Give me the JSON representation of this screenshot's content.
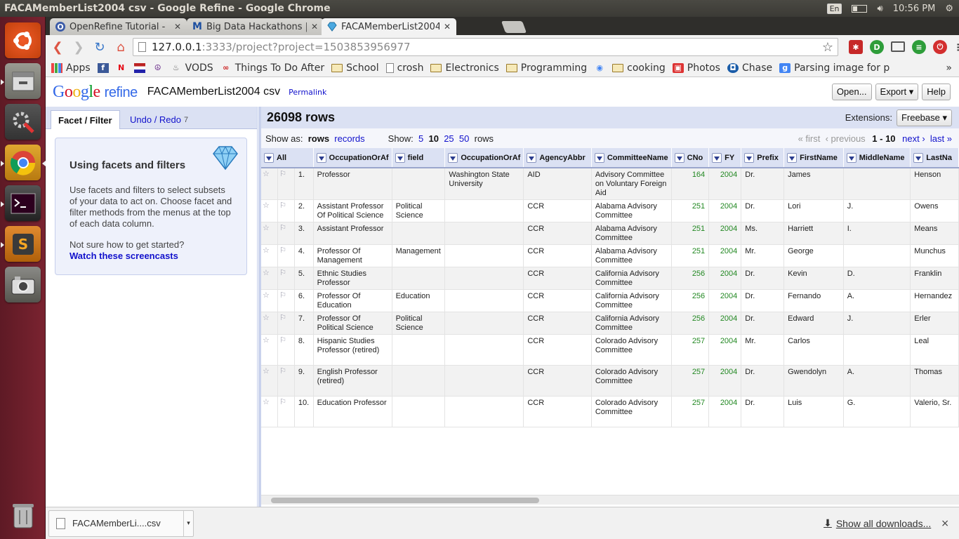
{
  "window": {
    "title": "FACAMemberList2004 csv - Google Refine - Google Chrome",
    "keyboard": "En",
    "clock": "10:56 PM"
  },
  "tabs": [
    {
      "label": "OpenRefine Tutorial -",
      "favicon": "O"
    },
    {
      "label": "Big Data Hackathons |",
      "favicon": "M"
    },
    {
      "label": "FACAMemberList2004",
      "favicon": "diamond"
    }
  ],
  "address": {
    "host": "127.0.0.1",
    "rest": ":3333/project?project=1503853956977"
  },
  "bookmarks": [
    "Apps",
    "",
    "",
    "",
    "",
    "VODS",
    "Things To Do After",
    "School",
    "crosh",
    "Electronics",
    "Programming",
    "",
    "cooking",
    "Photos",
    "Chase",
    "Parsing image for p"
  ],
  "bookmarks_more": "»",
  "app": {
    "logo_parts": [
      "G",
      "o",
      "o",
      "g",
      "l",
      "e"
    ],
    "logo_refine": "refine",
    "project_name": "FACAMemberList2004 csv",
    "permalink": "Permalink",
    "buttons": {
      "open": "Open...",
      "export": "Export ▾",
      "help": "Help"
    }
  },
  "left_panel": {
    "tab_facet": "Facet / Filter",
    "tab_undo": "Undo / Redo",
    "undo_count": "7",
    "help_title": "Using facets and filters",
    "help_text": "Use facets and filters to select subsets of your data to act on. Choose facet and filter methods from the menus at the top of each data column.",
    "help_prompt": "Not sure how to get started?",
    "help_link": "Watch these screencasts"
  },
  "view": {
    "row_count": "26098 rows",
    "extensions_label": "Extensions:",
    "extensions_button": "Freebase ▾",
    "show_as_label": "Show as:",
    "show_as_rows": "rows",
    "show_as_records": "records",
    "show_label": "Show:",
    "page_sizes": [
      "5",
      "10",
      "25",
      "50"
    ],
    "page_size_suffix": "rows",
    "pager_first": "« first",
    "pager_prev": "‹ previous",
    "pager_range": "1 - 10",
    "pager_next": "next ›",
    "pager_last": "last »"
  },
  "table": {
    "columns": [
      "All",
      "OccupationOrAf",
      "field",
      "OccupationOrAf",
      "AgencyAbbr",
      "CommitteeName",
      "CNo",
      "FY",
      "Prefix",
      "FirstName",
      "MiddleName",
      "LastNa"
    ],
    "rows": [
      [
        "1.",
        "Professor",
        "",
        "Washington State University",
        "AID",
        "Advisory Committee on Voluntary Foreign Aid",
        "164",
        "2004",
        "Dr.",
        "James",
        "",
        "Henson"
      ],
      [
        "2.",
        "Assistant Professor Of Political Science",
        "Political Science",
        "",
        "CCR",
        "Alabama Advisory Committee",
        "251",
        "2004",
        "Dr.",
        "Lori",
        "J.",
        "Owens"
      ],
      [
        "3.",
        "Assistant Professor",
        "",
        "",
        "CCR",
        "Alabama Advisory Committee",
        "251",
        "2004",
        "Ms.",
        "Harriett",
        "I.",
        "Means"
      ],
      [
        "4.",
        "Professor Of Management",
        "Management",
        "",
        "CCR",
        "Alabama Advisory Committee",
        "251",
        "2004",
        "Mr.",
        "George",
        "",
        "Munchus"
      ],
      [
        "5.",
        "Ethnic Studies Professor",
        "",
        "",
        "CCR",
        "California Advisory Committee",
        "256",
        "2004",
        "Dr.",
        "Kevin",
        "D.",
        "Franklin"
      ],
      [
        "6.",
        "Professor Of Education",
        "Education",
        "",
        "CCR",
        "California Advisory Committee",
        "256",
        "2004",
        "Dr.",
        "Fernando",
        "A.",
        "Hernandez"
      ],
      [
        "7.",
        "Professor Of Political Science",
        "Political Science",
        "",
        "CCR",
        "California Advisory Committee",
        "256",
        "2004",
        "Dr.",
        "Edward",
        "J.",
        "Erler"
      ],
      [
        "8.",
        "Hispanic Studies Professor (retired)",
        "",
        "",
        "CCR",
        "Colorado Advisory Committee",
        "257",
        "2004",
        "Mr.",
        "Carlos",
        "",
        "Leal"
      ],
      [
        "9.",
        "English Professor (retired)",
        "",
        "",
        "CCR",
        "Colorado Advisory Committee",
        "257",
        "2004",
        "Dr.",
        "Gwendolyn",
        "A.",
        "Thomas"
      ],
      [
        "10.",
        "Education Professor",
        "",
        "",
        "CCR",
        "Colorado Advisory Committee",
        "257",
        "2004",
        "Dr.",
        "Luis",
        "G.",
        "Valerio, Sr."
      ]
    ]
  },
  "downloads": {
    "file": "FACAMemberLi....csv",
    "show_all": "Show all downloads...",
    "close": "×"
  }
}
